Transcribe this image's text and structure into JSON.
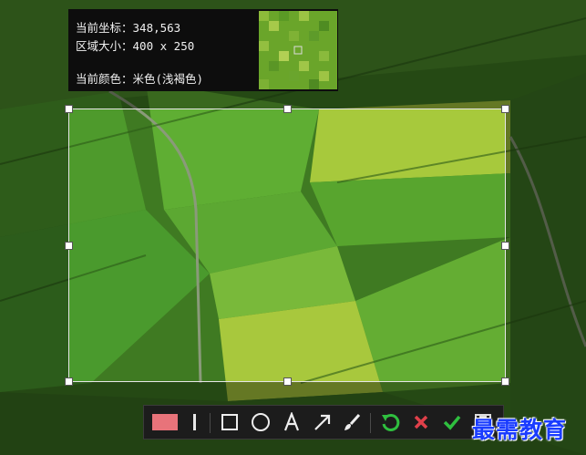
{
  "info_panel": {
    "coord_label": "当前坐标：",
    "coord_value": "348,563",
    "size_label": "区域大小：",
    "size_value": "400 x 250",
    "color_label": "当前颜色：",
    "color_value": "米色(浅褐色)"
  },
  "toolbar": {
    "color_swatch": "#e8737a",
    "icons": [
      "color-swatch",
      "pen-size",
      "rectangle",
      "ellipse",
      "text",
      "arrow",
      "brush",
      "undo",
      "cancel",
      "confirm",
      "save"
    ]
  },
  "watermark": {
    "text": "最需教育"
  },
  "colors": {
    "undo": "#2fbf3f",
    "cancel": "#e0404a",
    "confirm": "#2fbf3f",
    "watermark": "#1a3cff"
  }
}
